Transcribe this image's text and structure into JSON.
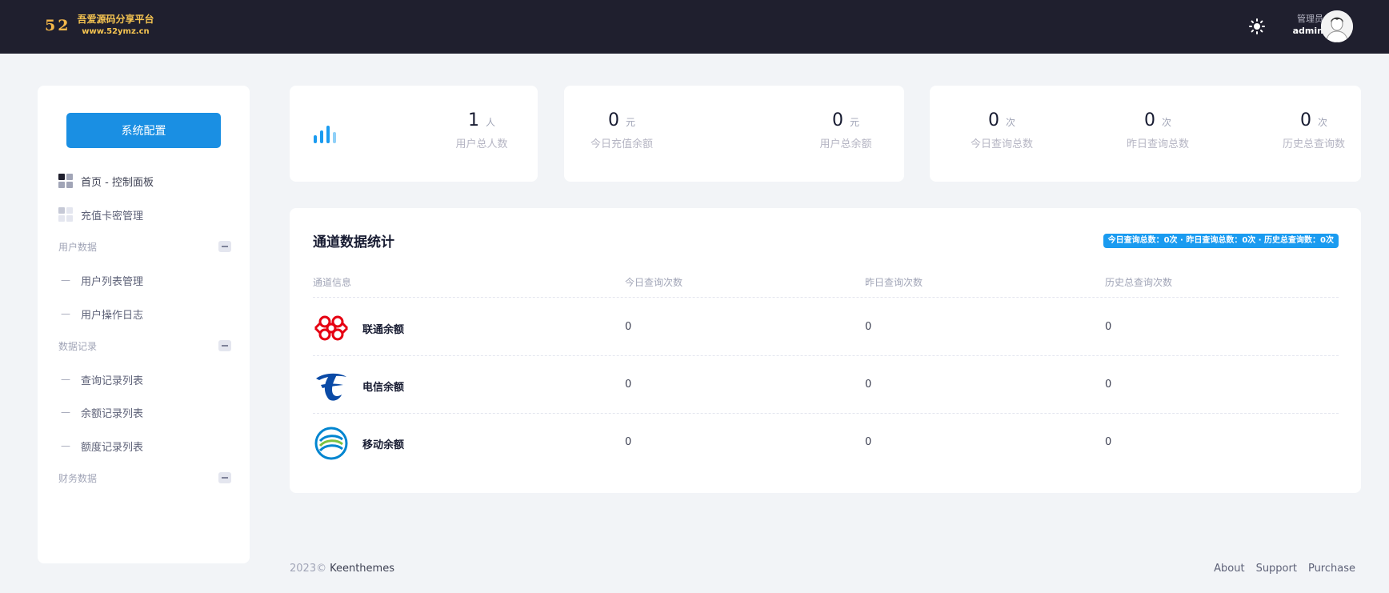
{
  "header": {
    "logo_number": "52",
    "logo_title": "吾爱源码分享平台",
    "logo_url": "www.52ymz.cn",
    "user_role": "管理员",
    "user_name": "admin",
    "theme_icon": "sun-icon",
    "colors": {
      "bar": "#1f1f2e",
      "logo": "#f5c451"
    }
  },
  "sidebar": {
    "config_button": "系统配置",
    "items": [
      {
        "label": "首页 - 控制面板",
        "icon": "dashboard-icon",
        "active": true
      },
      {
        "label": "充值卡密管理",
        "icon": "dashboard-icon",
        "active": false
      }
    ],
    "sections": [
      {
        "title": "用户数据",
        "items": [
          "用户列表管理",
          "用户操作日志"
        ]
      },
      {
        "title": "数据记录",
        "items": [
          "查询记录列表",
          "余额记录列表",
          "额度记录列表"
        ]
      },
      {
        "title": "财务数据",
        "items": []
      }
    ]
  },
  "stats": {
    "card1": {
      "icon": "bar-chart-icon",
      "value": "1",
      "unit": "人",
      "label": "用户总人数"
    },
    "card2": [
      {
        "value": "0",
        "unit": "元",
        "label": "今日充值余额"
      },
      {
        "value": "0",
        "unit": "元",
        "label": "用户总余额"
      }
    ],
    "card3": [
      {
        "value": "0",
        "unit": "次",
        "label": "今日查询总数"
      },
      {
        "value": "0",
        "unit": "次",
        "label": "昨日查询总数"
      },
      {
        "value": "0",
        "unit": "次",
        "label": "历史总查询数"
      }
    ]
  },
  "channel_table": {
    "title": "通道数据统计",
    "summary": "今日查询总数：0次 · 昨日查询总数：0次 · 历史总查询数：0次",
    "columns": [
      "通道信息",
      "今日查询次数",
      "昨日查询次数",
      "历史总查询次数"
    ],
    "rows": [
      {
        "name": "联通余额",
        "logo": "china-unicom-logo",
        "today": "0",
        "yesterday": "0",
        "total": "0"
      },
      {
        "name": "电信余额",
        "logo": "china-telecom-logo",
        "today": "0",
        "yesterday": "0",
        "total": "0"
      },
      {
        "name": "移动余额",
        "logo": "china-mobile-logo",
        "today": "0",
        "yesterday": "0",
        "total": "0"
      }
    ]
  },
  "footer": {
    "year": "2023©",
    "company": "Keenthemes",
    "links": [
      "About",
      "Support",
      "Purchase"
    ]
  }
}
